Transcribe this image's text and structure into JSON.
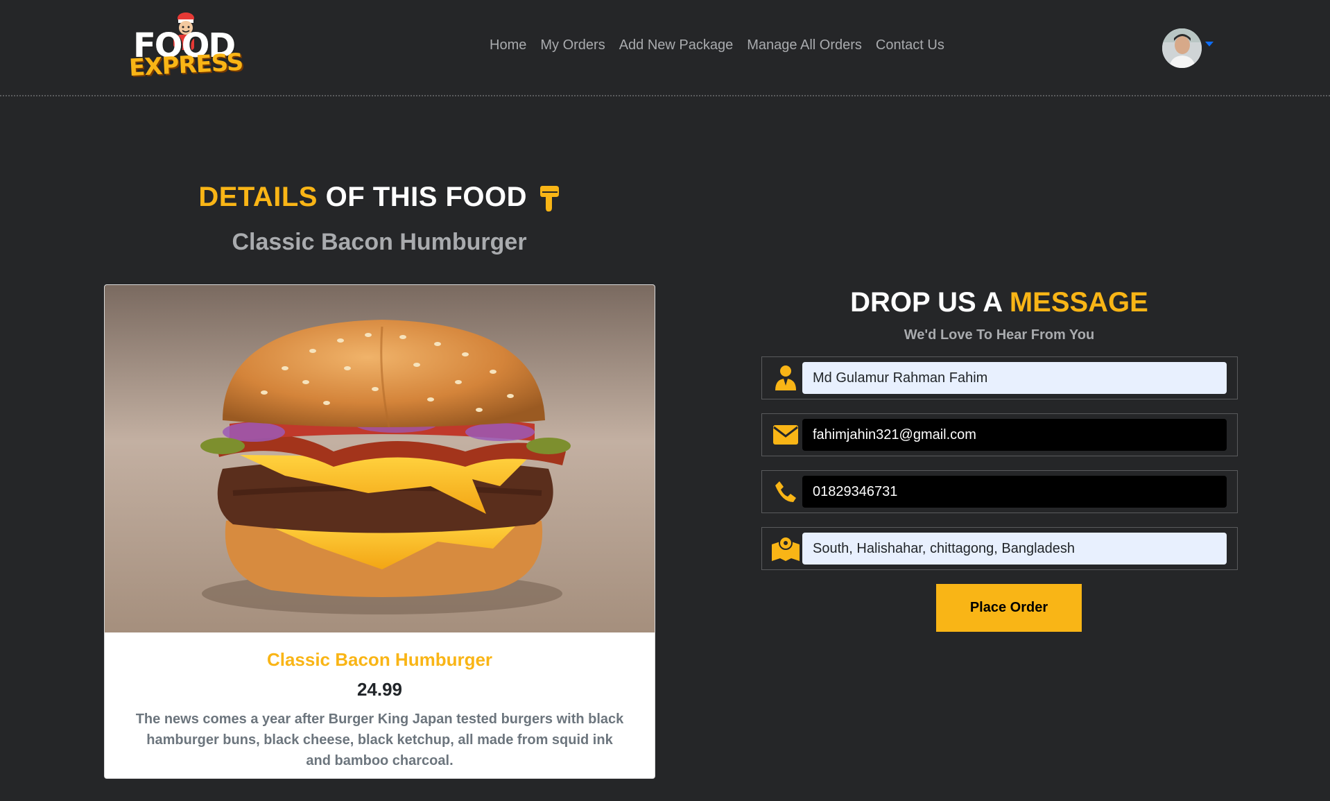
{
  "brand": {
    "logo_top": "FOOD",
    "logo_bottom": "EXPRESS",
    "accent_color": "#f9b516"
  },
  "nav": {
    "items": [
      {
        "label": "Home"
      },
      {
        "label": "My Orders"
      },
      {
        "label": "Add New Package"
      },
      {
        "label": "Manage All Orders"
      },
      {
        "label": "Contact Us"
      }
    ]
  },
  "user_menu": {
    "avatar_icon": "user-avatar",
    "caret_icon": "caret-down-icon"
  },
  "details": {
    "heading_accent": "DETAILS",
    "heading_rest": "OF THIS FOOD",
    "heading_icon": "hand-pointing-down-icon",
    "food_name": "Classic Bacon Humburger"
  },
  "card": {
    "title": "Classic Bacon Humburger",
    "price": "24.99",
    "description": "The news comes a year after Burger King Japan tested burgers with black hamburger buns, black cheese, black ketchup, all made from squid ink and bamboo charcoal."
  },
  "form": {
    "heading_rest": "DROP US A",
    "heading_accent": "MESSAGE",
    "subtitle": "We'd Love To Hear From You",
    "name_value": "Md Gulamur Rahman Fahim",
    "email_value": "fahimjahin321@gmail.com",
    "phone_value": "01829346731",
    "address_value": "South, Halishahar, chittagong, Bangladesh",
    "submit_label": "Place Order"
  }
}
